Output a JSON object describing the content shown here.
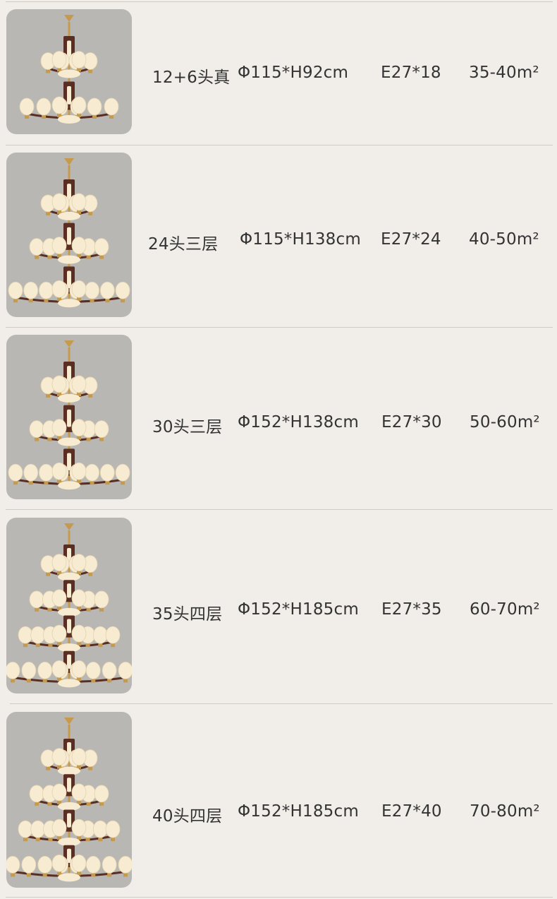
{
  "products": [
    {
      "name": "12+6头真",
      "size": "Φ115*H92cm",
      "bulbs": "E27*18",
      "area": "35-40m²",
      "tiers": 2
    },
    {
      "name": "24头三层",
      "size": "Φ115*H138cm",
      "bulbs": "E27*24",
      "area": "40-50m²",
      "tiers": 3
    },
    {
      "name": "30头三层",
      "size": "Φ152*H138cm",
      "bulbs": "E27*30",
      "area": "50-60m²",
      "tiers": 3
    },
    {
      "name": "35头四层",
      "size": "Φ152*H185cm",
      "bulbs": "E27*35",
      "area": "60-70m²",
      "tiers": 4
    },
    {
      "name": "40头四层",
      "size": "Φ152*H185cm",
      "bulbs": "E27*40",
      "area": "70-80m²",
      "tiers": 4
    }
  ],
  "colors": {
    "background": "#f1eeea",
    "thumbnail_bg": "#b9b7b3",
    "lamp_shade": "#f7ecd2",
    "wood": "#5a2e22",
    "brass": "#c69a4c",
    "text": "#333333",
    "divider": "#cfcac4"
  }
}
